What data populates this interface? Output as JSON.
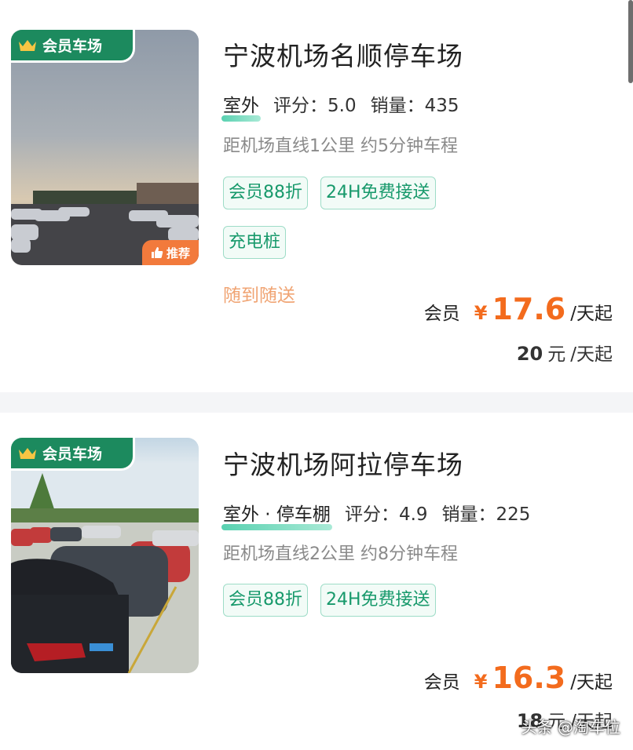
{
  "listings": [
    {
      "member_badge": "会员车场",
      "recommend_badge": "推荐",
      "name": "宁波机场名顺停车场",
      "env": "室外",
      "rating_label": "评分：",
      "rating": "5.0",
      "sales_label": "销量：",
      "sales": "435",
      "distance": "距机场直线1公里 约5分钟车程",
      "tags": [
        "会员88折",
        "24H免费接送",
        "充电桩"
      ],
      "delivery": "随到随送",
      "member_price_label": "会员",
      "currency": "¥",
      "member_price": "17.6",
      "price_unit": "/天起",
      "original_price": "20",
      "original_unit": "元",
      "original_suffix": "/天起"
    },
    {
      "member_badge": "会员车场",
      "name": "宁波机场阿拉停车场",
      "env": "室外 · 停车棚",
      "rating_label": "评分：",
      "rating": "4.9",
      "sales_label": "销量：",
      "sales": "225",
      "distance": "距机场直线2公里 约8分钟车程",
      "tags": [
        "会员88折",
        "24H免费接送"
      ],
      "member_price_label": "会员",
      "currency": "¥",
      "member_price": "16.3",
      "price_unit": "/天起",
      "original_price": "18",
      "original_unit": "元",
      "original_suffix": "/天起"
    }
  ],
  "watermark": "头条 @淘车位",
  "colors": {
    "accent_green": "#1c8a5e",
    "tag_green": "#17996b",
    "price_orange": "#f36b1d",
    "recommend_orange": "#f27a3c"
  }
}
